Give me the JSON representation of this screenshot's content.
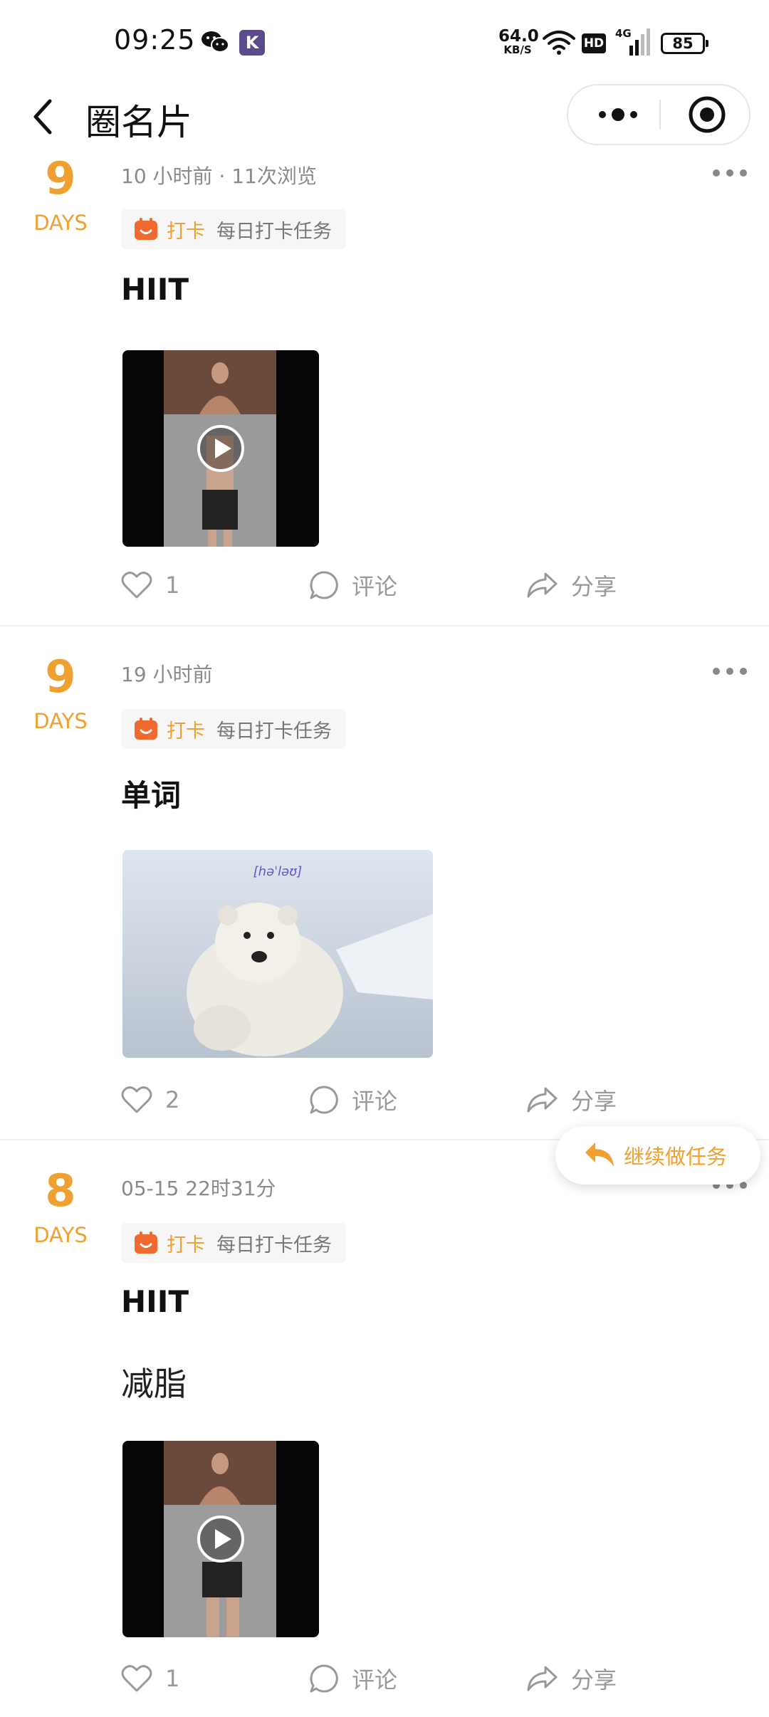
{
  "status_bar": {
    "time": "09:25",
    "app_badge": "K",
    "net_speed_value": "64.0",
    "net_speed_unit": "KB/S",
    "hd": "HD",
    "network": "4G",
    "battery": "85"
  },
  "nav": {
    "title": "圈名片"
  },
  "posts": [
    {
      "days_num": "9",
      "days_label": "DAYS",
      "meta": "10 小时前 · 11次浏览",
      "tag_label": "打卡",
      "tag_task": "每日打卡任务",
      "text": "HIIT",
      "likes": "1",
      "comment_label": "评论",
      "share_label": "分享"
    },
    {
      "days_num": "9",
      "days_label": "DAYS",
      "meta": "19 小时前",
      "tag_label": "打卡",
      "tag_task": "每日打卡任务",
      "text": "单词",
      "image_phonetic": "[həˈləʊ]",
      "likes": "2",
      "comment_label": "评论",
      "share_label": "分享"
    },
    {
      "days_num": "8",
      "days_label": "DAYS",
      "meta": "05-15 22时31分",
      "tag_label": "打卡",
      "tag_task": "每日打卡任务",
      "text": "HIIT",
      "text2": "减脂",
      "likes": "1",
      "comment_label": "评论",
      "share_label": "分享"
    }
  ],
  "fab": {
    "label": "继续做任务"
  },
  "colors": {
    "accent": "#f0a030",
    "tag_icon": "#f06a30",
    "muted": "#8a8a8a"
  },
  "icons": [
    "back-icon",
    "more-dots-icon",
    "target-icon",
    "calendar-icon",
    "heart-icon",
    "comment-icon",
    "share-icon",
    "play-icon",
    "continue-arrow-icon",
    "wechat-icon",
    "wifi-icon",
    "signal-icon"
  ]
}
